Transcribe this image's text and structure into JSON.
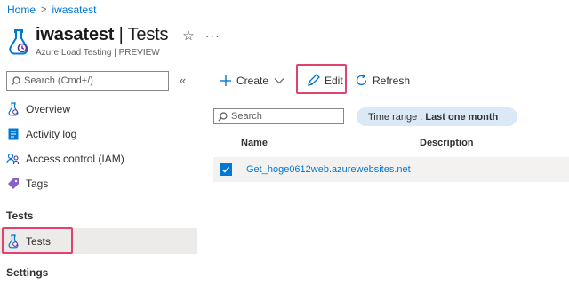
{
  "breadcrumb": {
    "home": "Home",
    "separator": ">",
    "current": "iwasatest"
  },
  "header": {
    "resource_name": "iwasatest",
    "separator": " | ",
    "blade_name": "Tests",
    "subtitle": "Azure Load Testing | PREVIEW",
    "icon": "load-testing-icon",
    "star_icon": "☆",
    "more_icon": "···"
  },
  "sidebar": {
    "search_placeholder": "Search (Cmd+/)",
    "collapse_icon": "«",
    "items": [
      {
        "label": "Overview",
        "icon": "load-testing-icon"
      },
      {
        "label": "Activity log",
        "icon": "activity-log-icon"
      },
      {
        "label": "Access control (IAM)",
        "icon": "people-icon"
      },
      {
        "label": "Tags",
        "icon": "tag-icon"
      }
    ],
    "section_tests": "Tests",
    "tests_item": {
      "label": "Tests",
      "icon": "load-testing-icon",
      "selected": true
    },
    "section_settings": "Settings"
  },
  "toolbar": {
    "create_label": "Create",
    "edit_label": "Edit",
    "refresh_label": "Refresh"
  },
  "filters": {
    "search_placeholder": "Search",
    "time_range_label": "Time range :",
    "time_range_value": "Last one month"
  },
  "table": {
    "columns": [
      "Name",
      "Description"
    ],
    "rows": [
      {
        "name": "Get_hoge0612web.azurewebsites.net",
        "description": "",
        "checked": true
      }
    ]
  },
  "colors": {
    "accent": "#0078d4",
    "highlight": "#e0446e",
    "selected_row": "#f3f2f1",
    "pill": "#dbe9f7"
  }
}
